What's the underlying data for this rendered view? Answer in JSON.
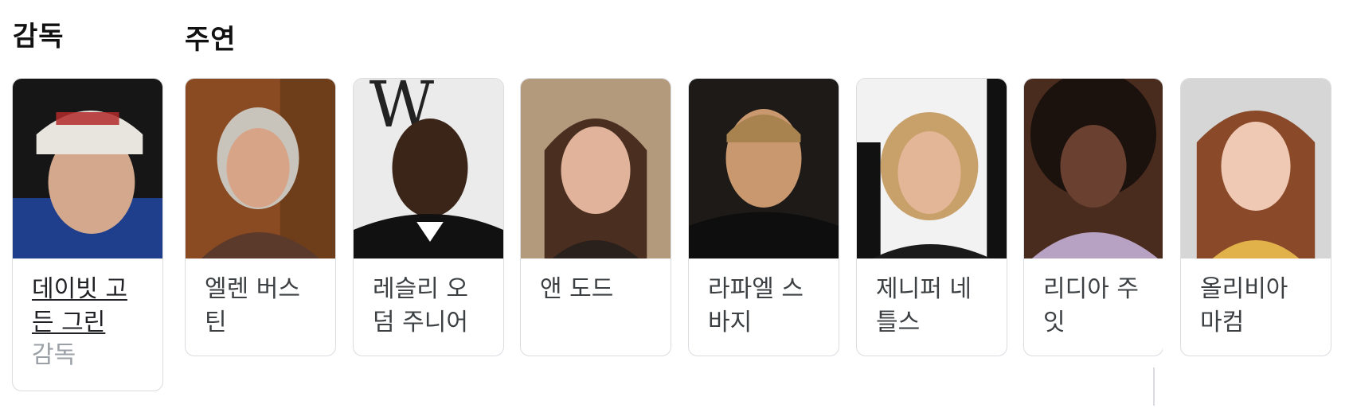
{
  "director_heading": "감독",
  "cast_heading": "주연",
  "director": {
    "name": "데이빗 고든 그린",
    "role": "감독"
  },
  "cast": [
    {
      "name": "엘렌 버스틴"
    },
    {
      "name": "레슬리 오덤 주니어"
    },
    {
      "name": "앤 도드"
    },
    {
      "name": "라파엘 스바지"
    },
    {
      "name": "제니퍼 네틀스"
    },
    {
      "name": "리디아 주잇"
    },
    {
      "name": "올리비아 마컴"
    }
  ],
  "photo_colors": {
    "director": "#2a2f38",
    "cast_0": "#8a4a22",
    "cast_1": "#e9e9e9",
    "cast_2": "#b39a7c",
    "cast_3": "#1d1a17",
    "cast_4": "#f2f2f2",
    "cast_5": "#4a2c1f",
    "cast_6": "#d6d6d6"
  }
}
